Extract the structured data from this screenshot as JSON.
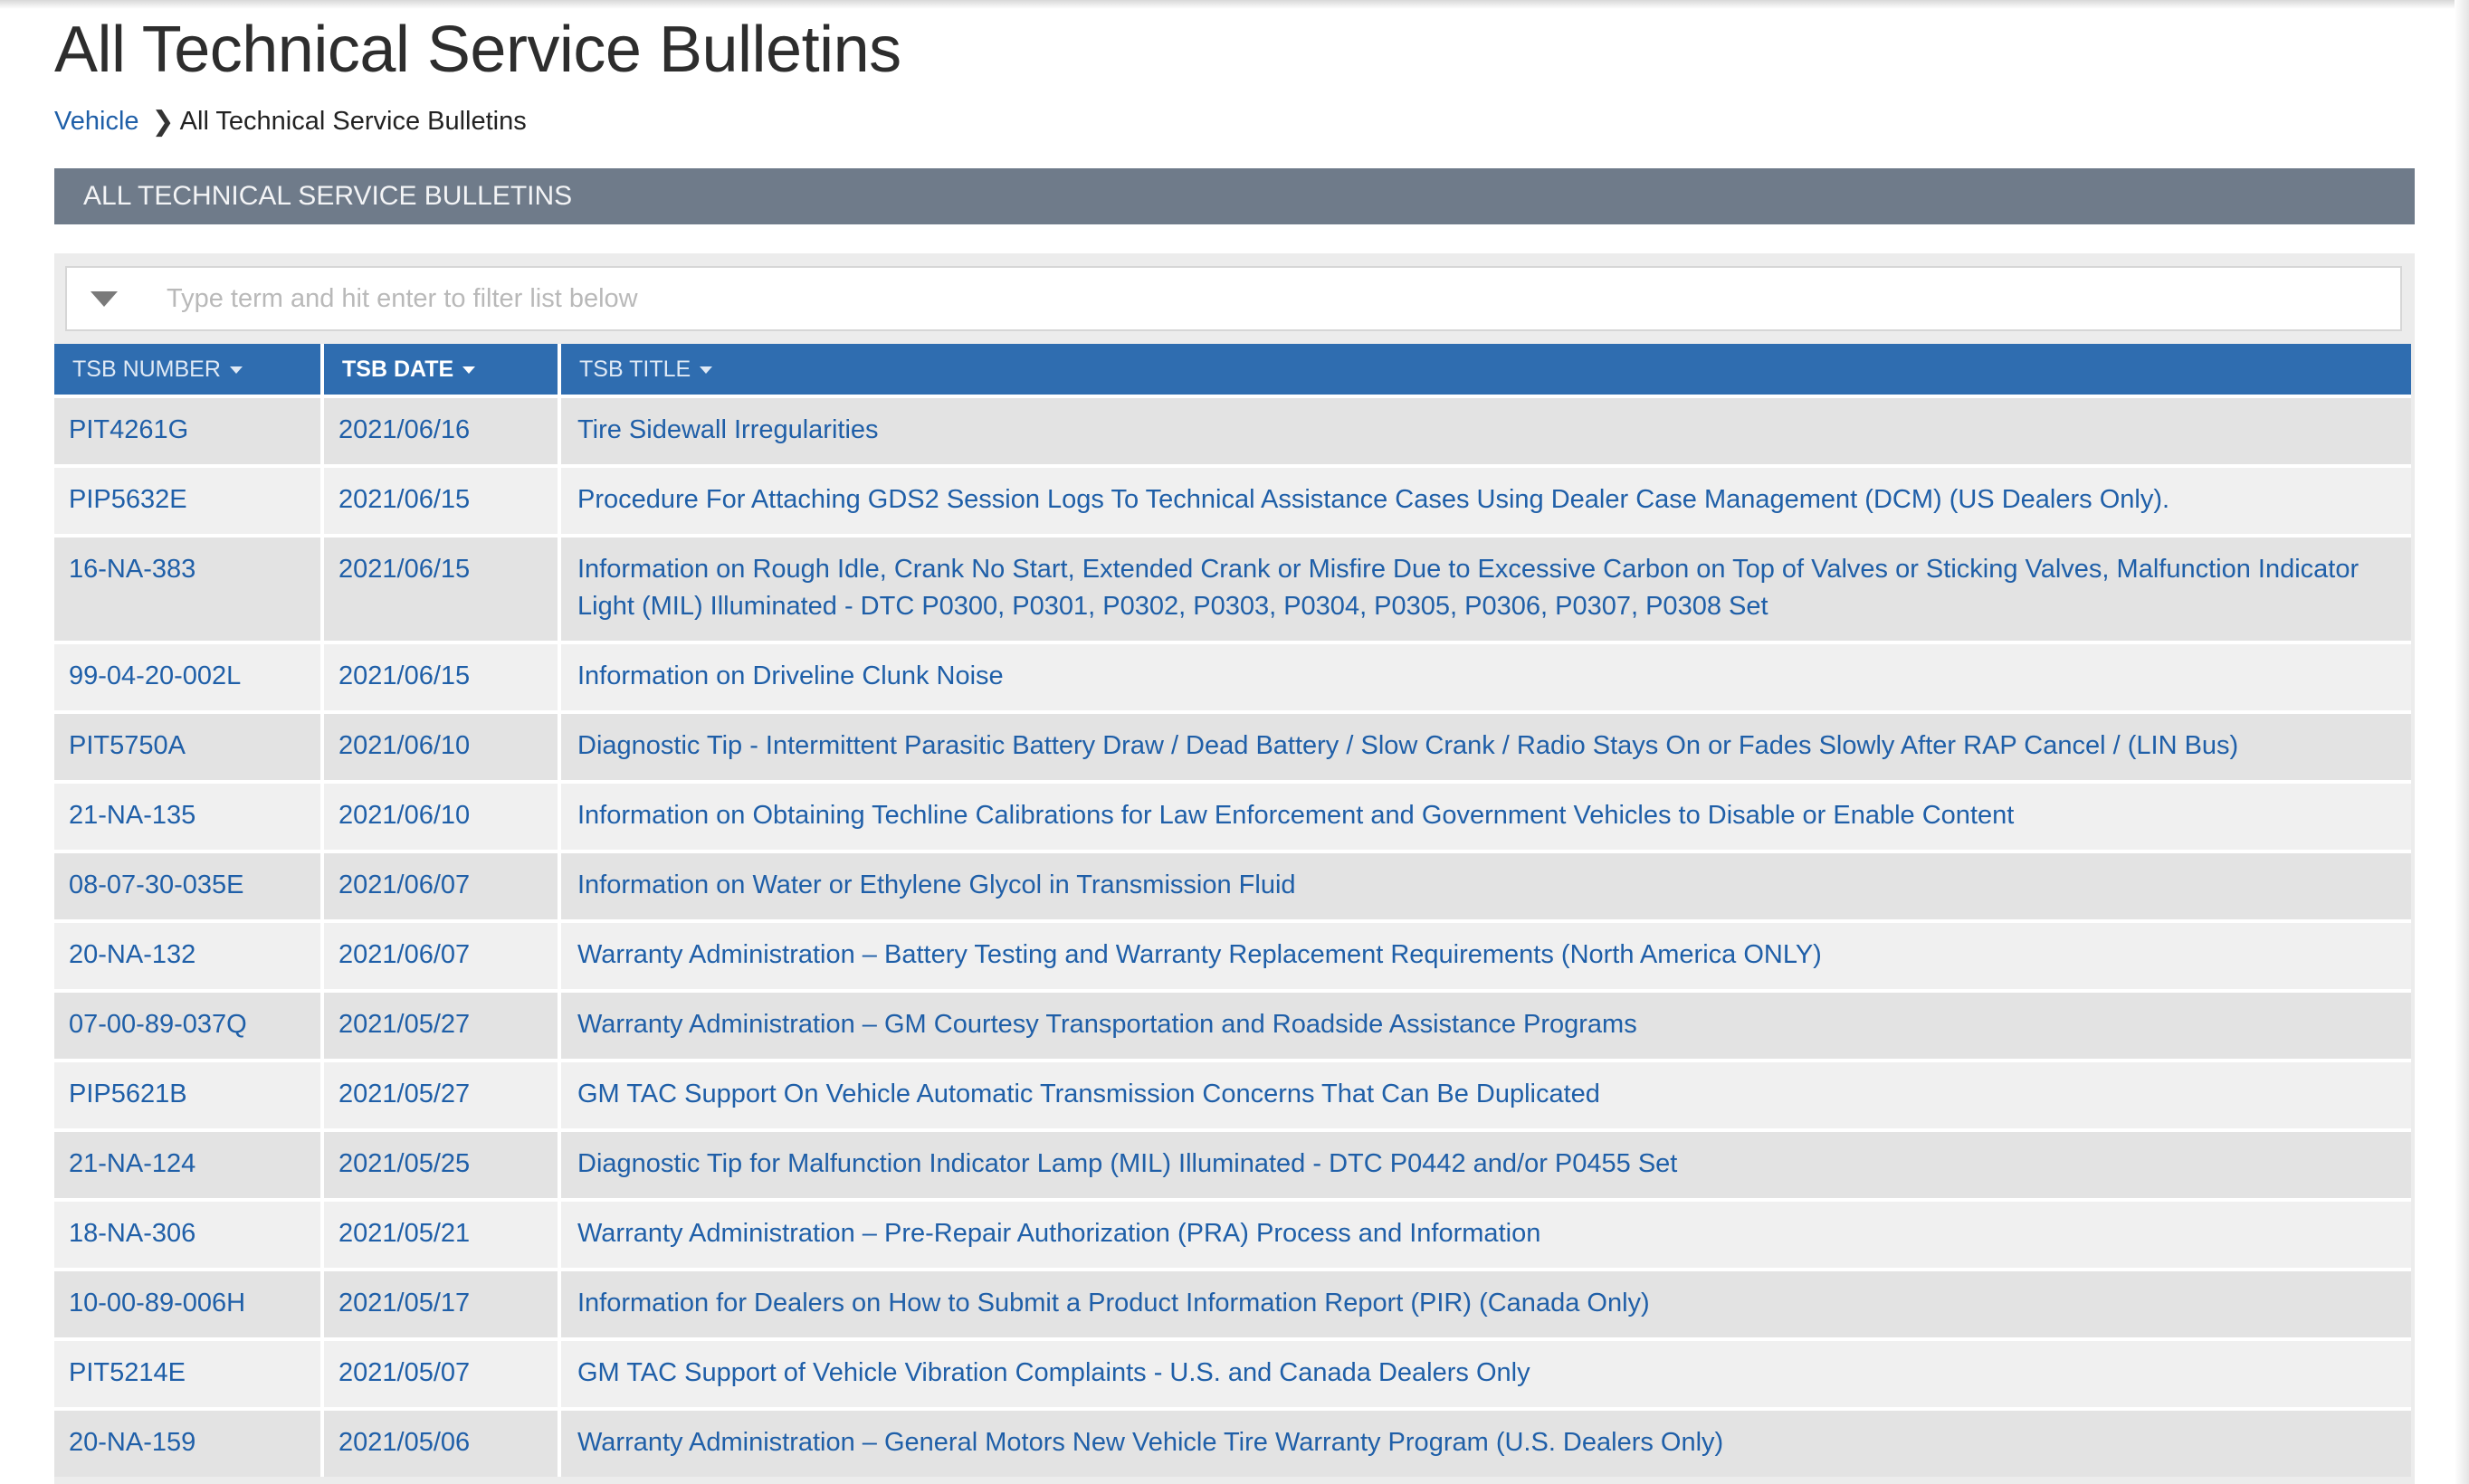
{
  "page": {
    "title": "All Technical Service Bulletins"
  },
  "breadcrumb": {
    "root": "Vehicle",
    "separator": "❯",
    "current": "All Technical Service Bulletins"
  },
  "section": {
    "title": "ALL TECHNICAL SERVICE BULLETINS"
  },
  "filter": {
    "placeholder": "Type term and hit enter to filter list below",
    "icon": "filter-icon"
  },
  "table": {
    "columns": [
      {
        "label": "TSB NUMBER",
        "sorted": false
      },
      {
        "label": "TSB DATE",
        "sorted": true
      },
      {
        "label": "TSB TITLE",
        "sorted": false
      }
    ],
    "rows": [
      {
        "number": "PIT4261G",
        "date": "2021/06/16",
        "title": "Tire Sidewall Irregularities"
      },
      {
        "number": "PIP5632E",
        "date": "2021/06/15",
        "title": "Procedure For Attaching GDS2 Session Logs To Technical Assistance Cases Using Dealer Case Management (DCM) (US Dealers Only)."
      },
      {
        "number": "16-NA-383",
        "date": "2021/06/15",
        "title": "Information on Rough Idle, Crank No Start, Extended Crank or Misfire Due to Excessive Carbon on Top of Valves or Sticking Valves, Malfunction Indicator Light (MIL) Illuminated - DTC P0300, P0301, P0302, P0303, P0304, P0305, P0306, P0307, P0308 Set"
      },
      {
        "number": "99-04-20-002L",
        "date": "2021/06/15",
        "title": "Information on Driveline Clunk Noise"
      },
      {
        "number": "PIT5750A",
        "date": "2021/06/10",
        "title": "Diagnostic Tip - Intermittent Parasitic Battery Draw / Dead Battery / Slow Crank / Radio Stays On or Fades Slowly After RAP Cancel / (LIN Bus)"
      },
      {
        "number": "21-NA-135",
        "date": "2021/06/10",
        "title": "Information on Obtaining Techline Calibrations for Law Enforcement and Government Vehicles to Disable or Enable Content"
      },
      {
        "number": "08-07-30-035E",
        "date": "2021/06/07",
        "title": "Information on Water or Ethylene Glycol in Transmission Fluid"
      },
      {
        "number": "20-NA-132",
        "date": "2021/06/07",
        "title": "Warranty Administration – Battery Testing and Warranty Replacement Requirements (North America ONLY)"
      },
      {
        "number": "07-00-89-037Q",
        "date": "2021/05/27",
        "title": "Warranty Administration – GM Courtesy Transportation and Roadside Assistance Programs"
      },
      {
        "number": "PIP5621B",
        "date": "2021/05/27",
        "title": "GM TAC Support On Vehicle Automatic Transmission Concerns That Can Be Duplicated"
      },
      {
        "number": "21-NA-124",
        "date": "2021/05/25",
        "title": "Diagnostic Tip for Malfunction Indicator Lamp (MIL) Illuminated - DTC P0442 and/or P0455 Set"
      },
      {
        "number": "18-NA-306",
        "date": "2021/05/21",
        "title": "Warranty Administration – Pre-Repair Authorization (PRA) Process and Information"
      },
      {
        "number": "10-00-89-006H",
        "date": "2021/05/17",
        "title": "Information for Dealers on How to Submit a Product Information Report (PIR) (Canada Only)"
      },
      {
        "number": "PIT5214E",
        "date": "2021/05/07",
        "title": "GM TAC Support of Vehicle Vibration Complaints - U.S. and Canada Dealers Only"
      },
      {
        "number": "20-NA-159",
        "date": "2021/05/06",
        "title": "Warranty Administration – General Motors New Vehicle Tire Warranty Program (U.S. Dealers Only)"
      }
    ]
  },
  "colors": {
    "link": "#1f5fa8",
    "header_bar": "#6f7b8a",
    "table_header": "#2f6db0",
    "row_odd": "#e3e3e3",
    "row_even": "#f0f0f0"
  }
}
